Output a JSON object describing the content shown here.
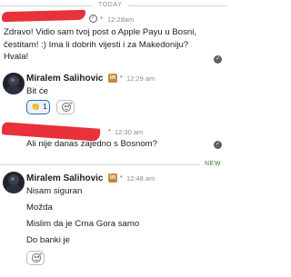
{
  "dividers": {
    "today": "TODAY",
    "new": "NEW"
  },
  "messages": [
    {
      "time": "12:28am",
      "text": "Zdravo! Vidio sam tvoj post o Apple Payu u Bosni, čestitam! :) Ima li dobrih vijesti i za Makedoniju? Hvala!"
    },
    {
      "sender": "Miralem Salihovic",
      "badge": "in",
      "time": "12:29 am",
      "text": "Bit će",
      "reaction": {
        "emoji": "👏",
        "count": "1"
      }
    },
    {
      "time": "12:30 am",
      "text": "Ali nije danas zajedno s Bosnom?"
    },
    {
      "sender": "Miralem Salihovic",
      "badge": "in",
      "time": "12:48 am",
      "lines": [
        "Nisam siguran",
        "Možda",
        "Mislim da je Crna Gora samo",
        "Do banki je"
      ]
    }
  ]
}
